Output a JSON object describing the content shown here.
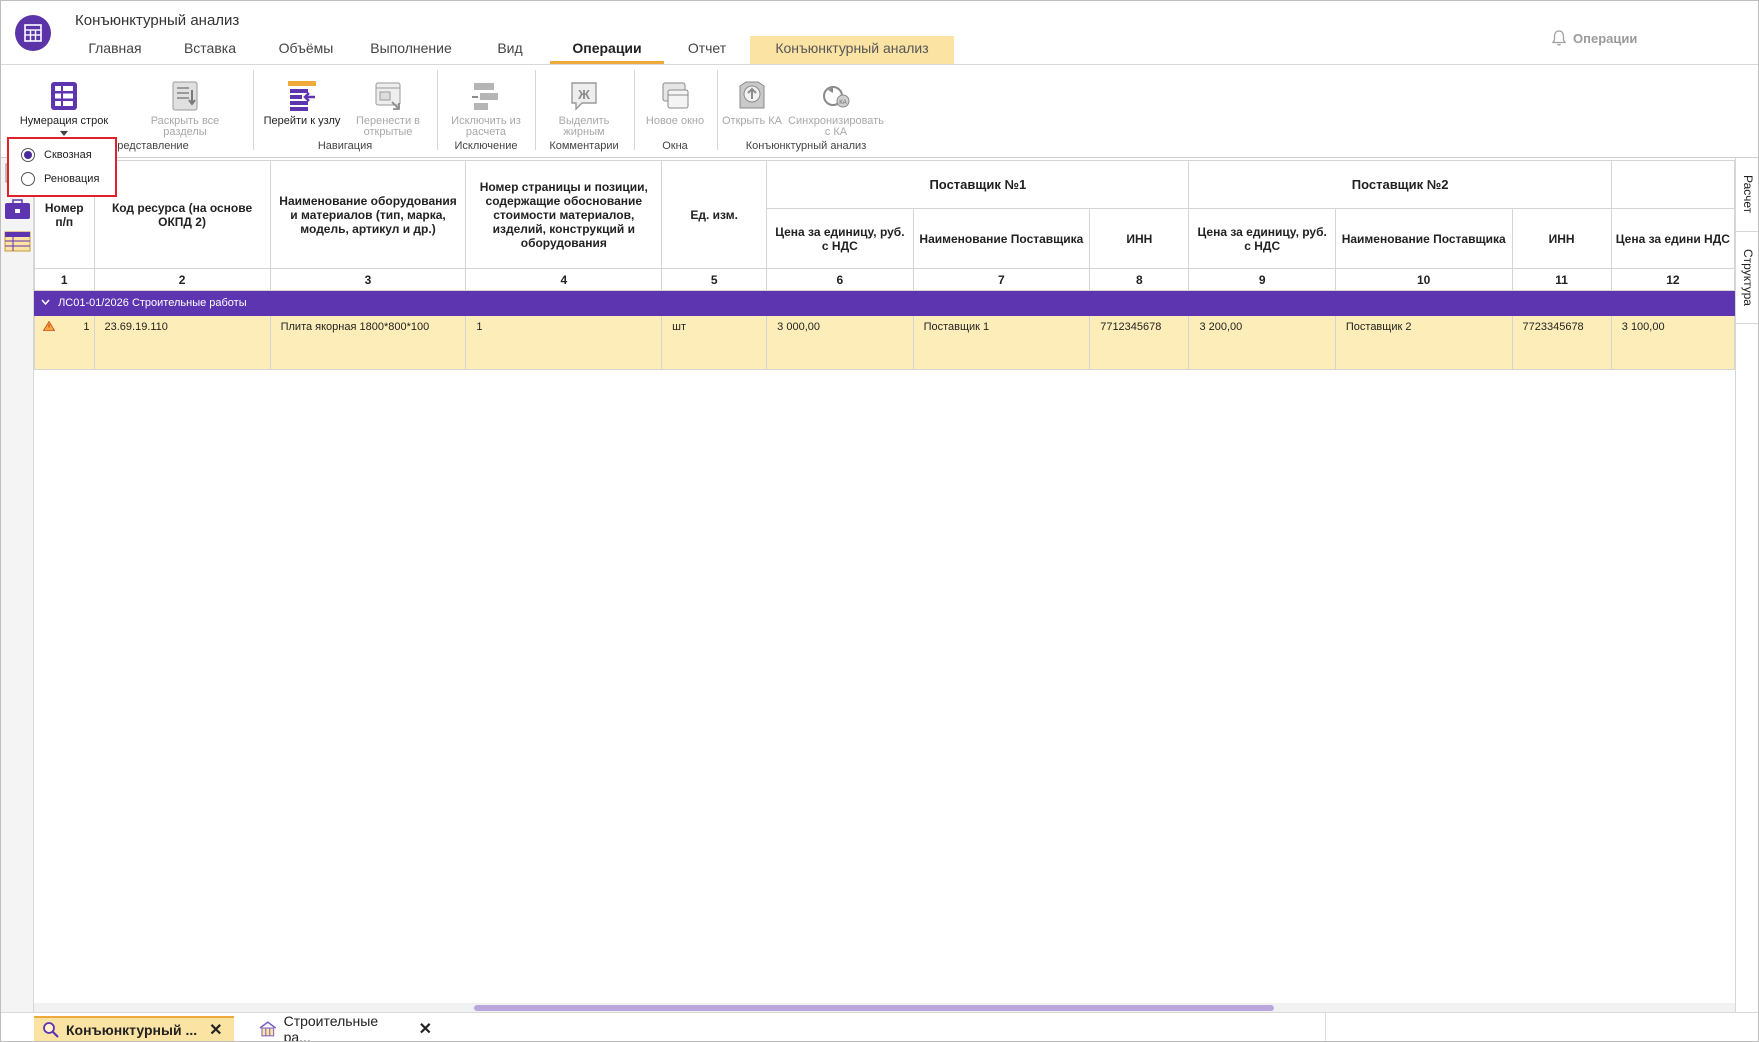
{
  "window": {
    "title": "Конъюнктурный анализ"
  },
  "ribbon_tabs": [
    {
      "label": "Главная"
    },
    {
      "label": "Вставка"
    },
    {
      "label": "Объёмы"
    },
    {
      "label": "Выполнение"
    },
    {
      "label": "Вид"
    },
    {
      "label": "Операции",
      "active": true
    },
    {
      "label": "Отчет"
    },
    {
      "label": "Конъюнктурный анализ",
      "context": true
    }
  ],
  "notifications": {
    "label": "Операции",
    "icon": "bell-icon"
  },
  "ribbon": {
    "row_numbering": "Нумерация строк",
    "expand_all": "Раскрыть все разделы",
    "goto_node": "Перейти к узлу",
    "move_to_open": "Перенести в открытые",
    "exclude_from_calc": "Исключить из расчета",
    "bold": "Выделить жирным",
    "new_window": "Новое окно",
    "open_ka": "Открыть КА",
    "sync_ka": "Синхронизировать с КА",
    "groups": {
      "view": "Представление",
      "view_visible": "редставление",
      "navigation": "Навигация",
      "exclusion": "Исключение",
      "comments": "Комментарии",
      "windows": "Окна",
      "market_analysis": "Конъюнктурный анализ"
    }
  },
  "numbering_popup": {
    "options": [
      {
        "label": "Сквозная",
        "selected": true
      },
      {
        "label": "Реновация",
        "selected": false
      }
    ]
  },
  "table": {
    "headers": {
      "num": "Номер п/п",
      "code": "Код ресурса (на основе ОКПД 2)",
      "name": "Наименование оборудования и материалов (тип, марка, модель, артикул и др.)",
      "page": "Номер страницы и позиции, содержащие обоснование стоимости материалов, изделий, конструкций и оборудования",
      "unit": "Ед. изм.",
      "supplier1": "Поставщик №1",
      "supplier2": "Поставщик №2",
      "price": "Цена за единицу, руб. с НДС",
      "supplier_name": "Наименование Поставщика",
      "inn": "ИНН",
      "price_cut": "Цена за едини НДС"
    },
    "column_numbers": [
      "1",
      "2",
      "3",
      "4",
      "5",
      "6",
      "7",
      "8",
      "9",
      "10",
      "11",
      "12"
    ],
    "group": {
      "label": "ЛС01-01/2026 Строительные работы"
    },
    "rows": [
      {
        "num": "1",
        "code": "23.69.19.110",
        "name": "Плита якорная 1800*800*100",
        "page": "1",
        "unit": "шт",
        "price1": "3 000,00",
        "supplier1": "Поставщик 1",
        "inn1": "7712345678",
        "price2": "3 200,00",
        "supplier2": "Поставщик 2",
        "inn2": "7723345678",
        "price3": "3 100,00"
      }
    ]
  },
  "side_tabs": {
    "calc": "Расчет",
    "structure": "Структура"
  },
  "bottom_tabs": [
    {
      "label": "Конъюнктурный ...",
      "active": true,
      "icon": "search-doc-icon"
    },
    {
      "label": "Строительные ра...",
      "active": false,
      "icon": "building-icon"
    }
  ],
  "colors": {
    "accent": "#5e35b1",
    "highlight": "#fdeeb9",
    "tab_underline": "#f0a93b",
    "context_tab": "#fbe3a4"
  }
}
